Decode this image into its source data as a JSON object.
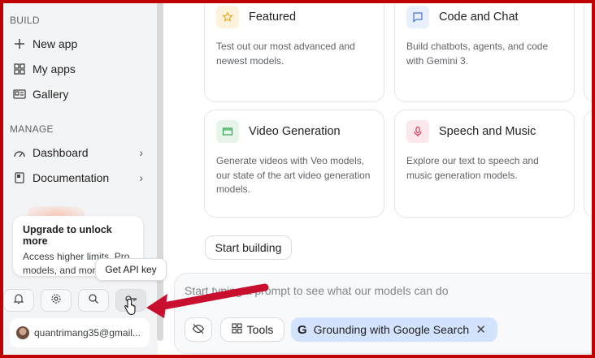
{
  "sidebar": {
    "build_label": "BUILD",
    "build_items": [
      {
        "label": "New app",
        "icon": "plus-icon"
      },
      {
        "label": "My apps",
        "icon": "apps-grid-icon"
      },
      {
        "label": "Gallery",
        "icon": "gallery-icon"
      }
    ],
    "manage_label": "MANAGE",
    "manage_items": [
      {
        "label": "Dashboard",
        "icon": "dashboard-icon"
      },
      {
        "label": "Documentation",
        "icon": "documentation-icon"
      }
    ],
    "upgrade": {
      "title": "Upgrade to unlock more",
      "text": "Access higher limits, Pro models, and more"
    },
    "tooltip": "Get API key",
    "icon_buttons": [
      "bell-icon",
      "gear-icon",
      "search-icon",
      "key-icon"
    ],
    "account_email": "quantrimang35@gmail..."
  },
  "cards": [
    {
      "title": "Featured",
      "desc": "Test out our most advanced and newest models.",
      "icon": "star-icon",
      "icon_color": "#fdf3dc",
      "icon_fg": "#e8a317"
    },
    {
      "title": "Code and Chat",
      "desc": "Build chatbots, agents, and code with Gemini 3.",
      "icon": "chat-icon",
      "icon_color": "#e8f0fe",
      "icon_fg": "#4a6fd8"
    },
    {
      "title": "Video Generation",
      "desc": "Generate videos with Veo models, our state of the art video generation models.",
      "icon": "video-icon",
      "icon_color": "#e6f4ea",
      "icon_fg": "#34a853"
    },
    {
      "title": "Speech and Music",
      "desc": "Explore our text to speech and music generation models.",
      "icon": "microphone-icon",
      "icon_color": "#fce8ec",
      "icon_fg": "#d93b5c"
    }
  ],
  "start_building": "Start building",
  "prompt": {
    "placeholder": "Start typing a prompt to see what our models can do",
    "tools_label": "Tools",
    "grounding_label": "Grounding with Google Search"
  },
  "colors": {
    "accent_red": "#c00000",
    "chip_bg": "#d3e3fd"
  }
}
